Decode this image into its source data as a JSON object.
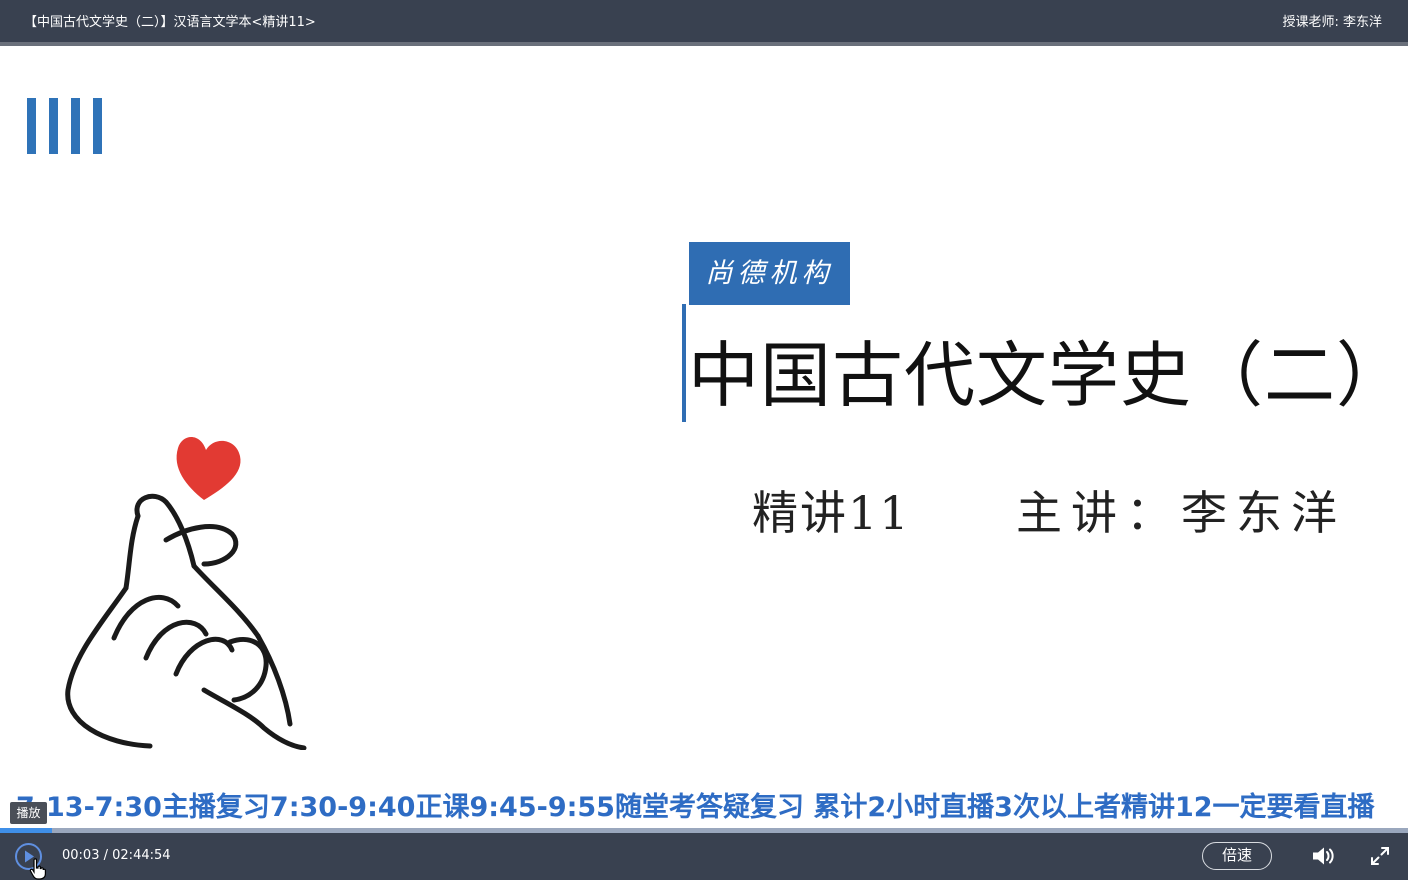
{
  "header": {
    "course_title": "【中国古代文学史（二）】汉语言文学本<精讲11>",
    "teacher": "授课老师: 李东洋"
  },
  "slide": {
    "org_label": "尚德机构",
    "title": "中国古代文学史（二）",
    "lecture": "精讲11",
    "lecturer": "主讲：李东洋",
    "accent_color": "#2f6db3",
    "heart_color": "#e23a33"
  },
  "marquee": {
    "text": "7-13-7:30主播复习7:30-9:40正课9:45-9:55随堂考答疑复习  累计2小时直播3次以上者精讲12一定要看直播"
  },
  "tooltip": {
    "play": "播放"
  },
  "player": {
    "current_time": "00:03",
    "separator": "/",
    "duration": "02:44:54",
    "speed_label": "倍速",
    "progress_fraction": 0.004,
    "icons": [
      "play-icon",
      "volume-icon",
      "fullscreen-icon"
    ]
  }
}
